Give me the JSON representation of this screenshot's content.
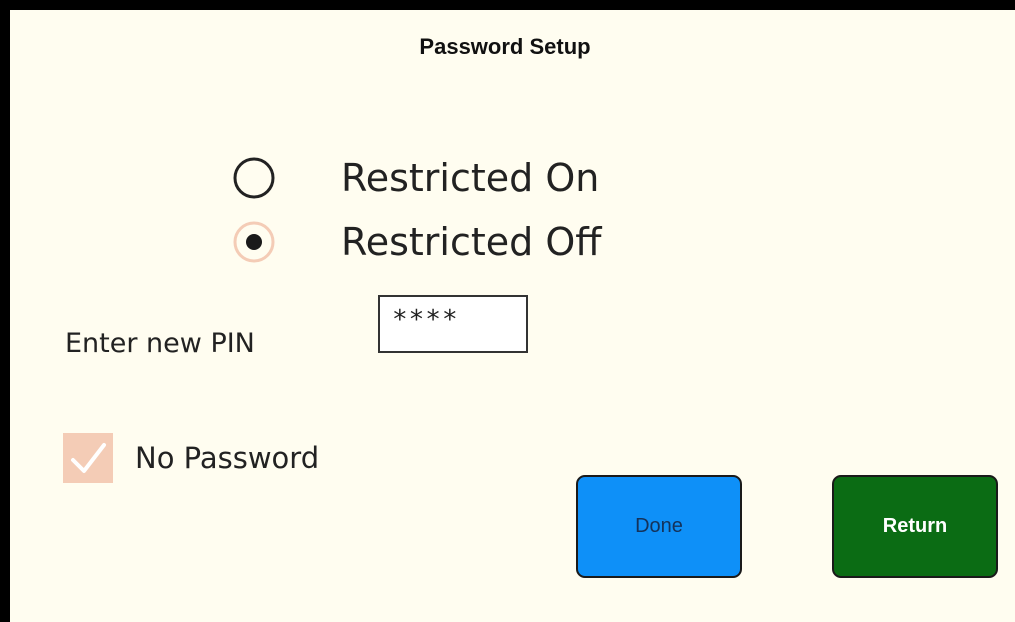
{
  "dialog": {
    "title": "Password Setup"
  },
  "restriction": {
    "options": [
      {
        "label": "Restricted On",
        "selected": false
      },
      {
        "label": "Restricted Off",
        "selected": true
      }
    ]
  },
  "pin": {
    "label": "Enter new PIN",
    "value": "****"
  },
  "no_password": {
    "label": "No Password",
    "checked": true
  },
  "buttons": {
    "done_label": "Done",
    "return_label": "Return"
  },
  "colors": {
    "background": "#fffdf0",
    "done_button": "#0e90f8",
    "return_button": "#0b6c14",
    "checkbox_fill": "#f4ccb6",
    "radio_selected_ring": "#f4ccb6"
  }
}
